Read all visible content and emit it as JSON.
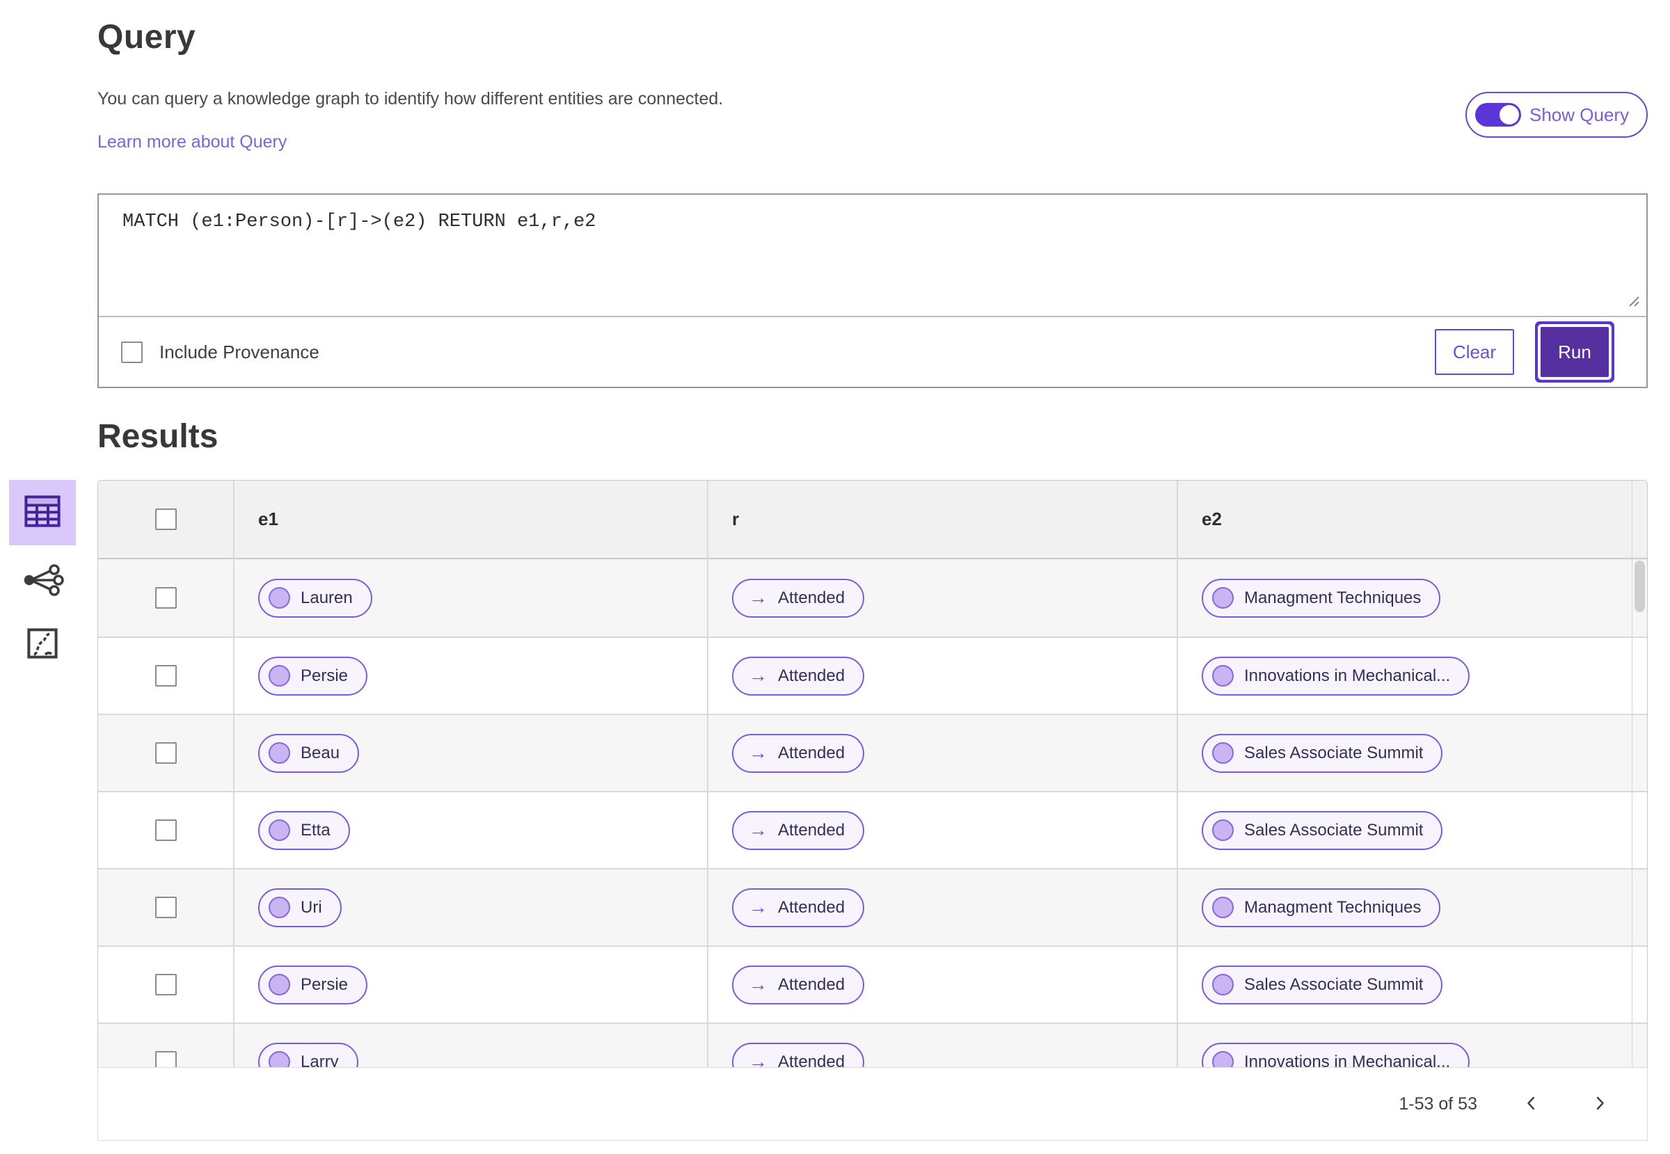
{
  "query_section": {
    "title": "Query",
    "description": "You can query a knowledge graph to identify how different entities are connected.",
    "learn_more_link": "Learn more about Query",
    "show_query_label": "Show Query",
    "show_query_toggle_state": "on",
    "query_text": "MATCH (e1:Person)-[r]->(e2) RETURN e1,r,e2",
    "include_provenance_label": "Include Provenance",
    "include_provenance_checked": false,
    "clear_label": "Clear",
    "run_label": "Run"
  },
  "results_section": {
    "title": "Results",
    "view_switcher": [
      "table-view",
      "graph-view",
      "chart-view"
    ],
    "selected_view": "table-view"
  },
  "table": {
    "columns": [
      "e1",
      "r",
      "e2"
    ],
    "rows": [
      {
        "e1": "Lauren",
        "r": "Attended",
        "e2": "Managment Techniques"
      },
      {
        "e1": "Persie",
        "r": "Attended",
        "e2": "Innovations in Mechanical..."
      },
      {
        "e1": "Beau",
        "r": "Attended",
        "e2": "Sales Associate Summit"
      },
      {
        "e1": "Etta",
        "r": "Attended",
        "e2": "Sales Associate Summit"
      },
      {
        "e1": "Uri",
        "r": "Attended",
        "e2": "Managment Techniques"
      },
      {
        "e1": "Persie",
        "r": "Attended",
        "e2": "Sales Associate Summit"
      },
      {
        "e1": "Larry",
        "r": "Attended",
        "e2": "Innovations in Mechanical..."
      }
    ]
  },
  "pagination": {
    "range_label": "1-53 of 53"
  },
  "icons": {
    "relation_arrow": "→"
  },
  "colors": {
    "accent_purple": "#5b35cf",
    "run_button_bg": "#56309f",
    "pill_border": "#7b5ce1",
    "pill_bg": "#f7f4fe",
    "node_fill": "#c8b5f1",
    "node_border": "#8a66e2",
    "selected_tile_bg": "#d9c8f9",
    "selected_icon": "#45239c",
    "link_purple": "#7e62dd",
    "header_row_bg": "#f1f1f1",
    "zebra_row_bg": "#f6f6f6"
  }
}
